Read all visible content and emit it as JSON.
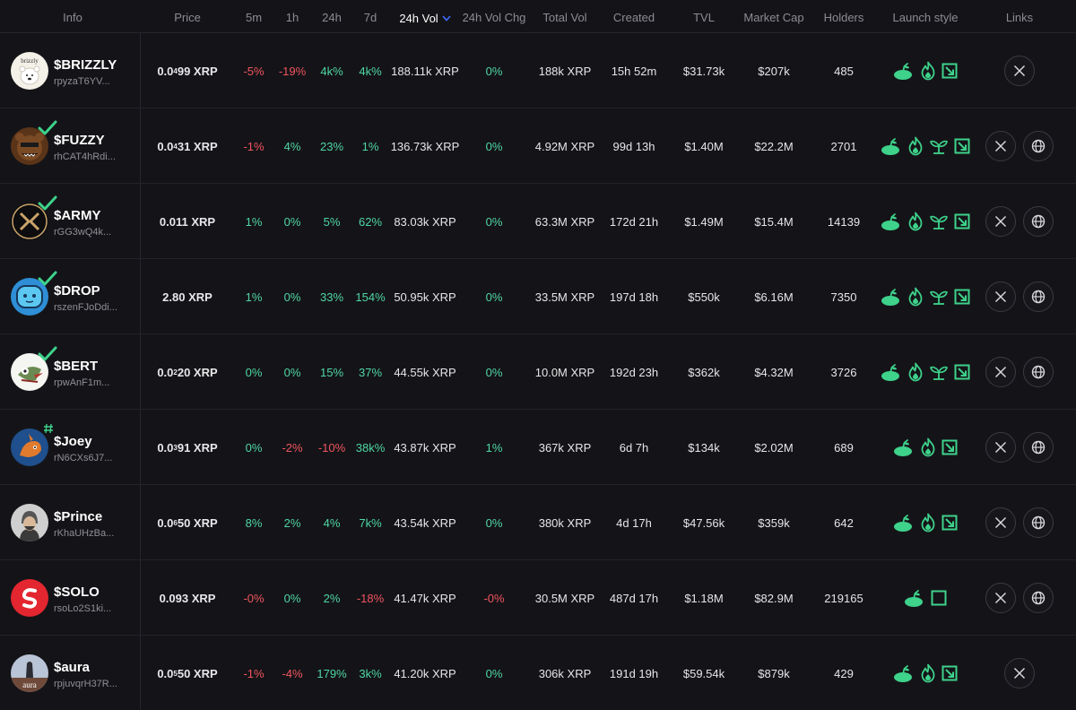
{
  "columns": {
    "info": "Info",
    "price": "Price",
    "m5": "5m",
    "h1": "1h",
    "h24": "24h",
    "d7": "7d",
    "vol24": "24h Vol",
    "vol24chg": "24h Vol Chg",
    "totalvol": "Total Vol",
    "created": "Created",
    "tvl": "TVL",
    "mcap": "Market Cap",
    "holders": "Holders",
    "launch": "Launch style",
    "links": "Links"
  },
  "colors": {
    "red": "#f0545e",
    "green": "#4fd6a3",
    "accent": "#3d6bff",
    "icon_green": "#3ed28b"
  },
  "rows": [
    {
      "ticker": "$BRIZZLY",
      "address": "rpyzaT6YV...",
      "price_lead": "0.0",
      "price_sub": "4",
      "price_tail": "99 XRP",
      "m5": "-5%",
      "h1": "-19%",
      "h24": "4k%",
      "d7": "4k%",
      "vol24": "188.11k XRP",
      "vol24chg": "0%",
      "totalvol": "188k XRP",
      "created": "15h 52m",
      "tvl": "$31.73k",
      "mcap": "$207k",
      "holders": "485",
      "avatar": "brizzly-bear-avatar",
      "verified": false
    },
    {
      "ticker": "$FUZZY",
      "address": "rhCAT4hRdi...",
      "price_lead": "0.0",
      "price_sub": "4",
      "price_tail": "31 XRP",
      "m5": "-1%",
      "h1": "4%",
      "h24": "23%",
      "d7": "1%",
      "vol24": "136.73k XRP",
      "vol24chg": "0%",
      "totalvol": "4.92M XRP",
      "created": "99d 13h",
      "tvl": "$1.40M",
      "mcap": "$22.2M",
      "holders": "2701",
      "avatar": "fuzzy-bear-avatar",
      "verified": true
    },
    {
      "ticker": "$ARMY",
      "address": "rGG3wQ4k...",
      "price_lead": "0.011 XRP",
      "price_sub": "",
      "price_tail": "",
      "m5": "1%",
      "h1": "0%",
      "h24": "5%",
      "d7": "62%",
      "vol24": "83.03k XRP",
      "vol24chg": "0%",
      "totalvol": "63.3M XRP",
      "created": "172d 21h",
      "tvl": "$1.49M",
      "mcap": "$15.4M",
      "holders": "14139",
      "avatar": "army-x-avatar",
      "verified": true
    },
    {
      "ticker": "$DROP",
      "address": "rszenFJoDdi...",
      "price_lead": "2.80 XRP",
      "price_sub": "",
      "price_tail": "",
      "m5": "1%",
      "h1": "0%",
      "h24": "33%",
      "d7": "154%",
      "vol24": "50.95k XRP",
      "vol24chg": "0%",
      "totalvol": "33.5M XRP",
      "created": "197d 18h",
      "tvl": "$550k",
      "mcap": "$6.16M",
      "holders": "7350",
      "avatar": "drop-blob-avatar",
      "verified": true
    },
    {
      "ticker": "$BERT",
      "address": "rpwAnF1m...",
      "price_lead": "0.0",
      "price_sub": "2",
      "price_tail": "20 XRP",
      "m5": "0%",
      "h1": "0%",
      "h24": "15%",
      "d7": "37%",
      "vol24": "44.55k XRP",
      "vol24chg": "0%",
      "totalvol": "10.0M XRP",
      "created": "192d 23h",
      "tvl": "$362k",
      "mcap": "$4.32M",
      "holders": "3726",
      "avatar": "bert-bird-avatar",
      "verified": true
    },
    {
      "ticker": "$Joey",
      "address": "rN6CXs6J7...",
      "price_lead": "0.0",
      "price_sub": "3",
      "price_tail": "91 XRP",
      "m5": "0%",
      "h1": "-2%",
      "h24": "-10%",
      "d7": "38k%",
      "vol24": "43.87k XRP",
      "vol24chg": "1%",
      "totalvol": "367k XRP",
      "created": "6d 7h",
      "tvl": "$134k",
      "mcap": "$2.02M",
      "holders": "689",
      "avatar": "joey-kangaroo-avatar",
      "verified": false
    },
    {
      "ticker": "$Prince",
      "address": "rKhaUHzBa...",
      "price_lead": "0.0",
      "price_sub": "6",
      "price_tail": "50 XRP",
      "m5": "8%",
      "h1": "2%",
      "h24": "4%",
      "d7": "7k%",
      "vol24": "43.54k XRP",
      "vol24chg": "0%",
      "totalvol": "380k XRP",
      "created": "4d 17h",
      "tvl": "$47.56k",
      "mcap": "$359k",
      "holders": "642",
      "avatar": "prince-portrait-avatar",
      "verified": false
    },
    {
      "ticker": "$SOLO",
      "address": "rsoLo2S1ki...",
      "price_lead": "0.093 XRP",
      "price_sub": "",
      "price_tail": "",
      "m5": "-0%",
      "h1": "0%",
      "h24": "2%",
      "d7": "-18%",
      "vol24": "41.47k XRP",
      "vol24chg": "-0%",
      "totalvol": "30.5M XRP",
      "created": "487d 17h",
      "tvl": "$1.18M",
      "mcap": "$82.9M",
      "holders": "219165",
      "avatar": "solo-logo-avatar",
      "verified": false
    },
    {
      "ticker": "$aura",
      "address": "rpjuvqrH37R...",
      "price_lead": "0.0",
      "price_sub": "5",
      "price_tail": "50 XRP",
      "m5": "-1%",
      "h1": "-4%",
      "h24": "179%",
      "d7": "3k%",
      "vol24": "41.20k XRP",
      "vol24chg": "0%",
      "totalvol": "306k XRP",
      "created": "191d 19h",
      "tvl": "$59.54k",
      "mcap": "$879k",
      "holders": "429",
      "avatar": "aura-avatar",
      "verified": false
    }
  ],
  "avatar_text": {
    "brizzly": "brizzly",
    "aura": "aura"
  },
  "launch_icons": [
    [
      "seed-bowl-icon",
      "flame-icon",
      "square-arrow-icon"
    ],
    [
      "seed-bowl-icon",
      "flame-icon",
      "sprout-icon",
      "square-arrow-icon"
    ],
    [
      "seed-bowl-icon",
      "flame-icon",
      "sprout-icon",
      "square-arrow-icon"
    ],
    [
      "seed-bowl-icon",
      "flame-icon",
      "sprout-icon",
      "square-arrow-icon"
    ],
    [
      "seed-bowl-icon",
      "flame-icon",
      "sprout-icon",
      "square-arrow-icon"
    ],
    [
      "seed-bowl-icon",
      "flame-icon",
      "square-arrow-icon"
    ],
    [
      "seed-bowl-icon",
      "flame-icon",
      "square-arrow-icon"
    ],
    [
      "seed-bowl-icon",
      "square-icon"
    ],
    [
      "seed-bowl-icon",
      "flame-icon",
      "square-arrow-icon"
    ]
  ],
  "link_icons": [
    [
      "x-logo-icon"
    ],
    [
      "x-logo-icon",
      "globe-icon"
    ],
    [
      "x-logo-icon",
      "globe-icon"
    ],
    [
      "x-logo-icon",
      "globe-icon"
    ],
    [
      "x-logo-icon",
      "globe-icon"
    ],
    [
      "x-logo-icon",
      "globe-icon"
    ],
    [
      "x-logo-icon",
      "globe-icon"
    ],
    [
      "x-logo-icon",
      "globe-icon"
    ],
    [
      "x-logo-icon"
    ]
  ]
}
